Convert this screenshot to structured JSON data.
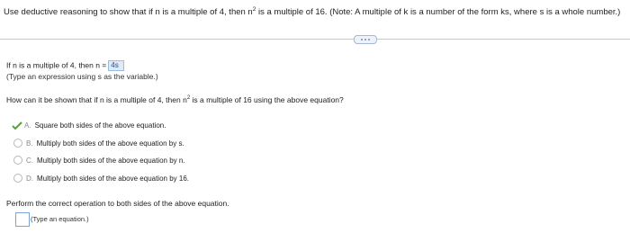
{
  "question": {
    "text_before_sup": "Use deductive reasoning to show that if n is a multiple of 4, then n",
    "sup": "2",
    "text_after_sup": " is a multiple of 16. (Note: A multiple of k is a number of the form ks, where s is a whole number.)"
  },
  "part1": {
    "prompt": "If n is a multiple of 4, then n =",
    "answer": "4s",
    "hint": "(Type an expression using s as the variable.)"
  },
  "part2": {
    "prompt_before_sup": "How can it be shown that if n is a multiple of 4, then n",
    "sup": "2",
    "prompt_after_sup": " is a multiple of 16 using the above equation?",
    "options": [
      {
        "letter": "A.",
        "text": "Square both sides of the above equation.",
        "selected": true
      },
      {
        "letter": "B.",
        "text": "Multiply both sides of the above equation by s.",
        "selected": false
      },
      {
        "letter": "C.",
        "text": "Multiply both sides of the above equation by n.",
        "selected": false
      },
      {
        "letter": "D.",
        "text": "Multiply both sides of the above equation by 16.",
        "selected": false
      }
    ]
  },
  "part3": {
    "prompt": "Perform the correct operation to both sides of the above equation.",
    "hint": "(Type an equation.)"
  },
  "colors": {
    "check": "#5a9e3a",
    "answer_bg": "#dfeaf8",
    "input_border": "#7aa4d6"
  }
}
